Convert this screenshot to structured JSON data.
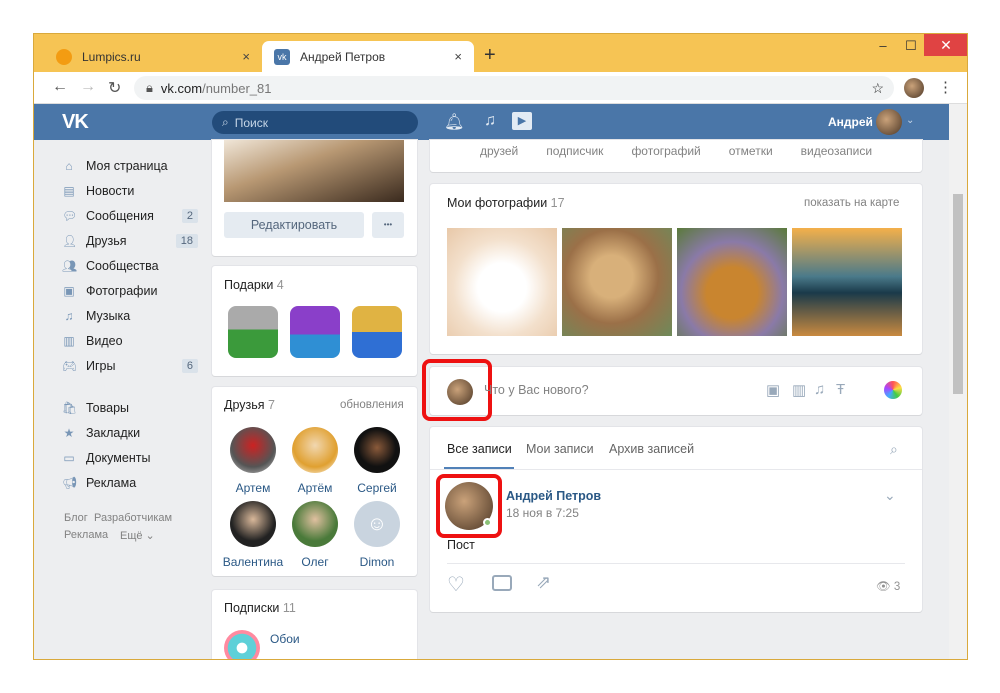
{
  "browser": {
    "tabs": [
      {
        "title": "Lumpics.ru",
        "close": "×"
      },
      {
        "title": "Андрей Петров",
        "close": "×"
      }
    ],
    "new_tab": "+",
    "window_controls": {
      "minimize": "–",
      "maximize": "☐",
      "close": "✕"
    },
    "url_host": "vk.com",
    "url_path": "/number_81"
  },
  "header": {
    "search_placeholder": "Поиск",
    "user_name": "Андрей"
  },
  "left_menu": [
    {
      "label": "Моя страница",
      "icon": "home-icon"
    },
    {
      "label": "Новости",
      "icon": "news-icon"
    },
    {
      "label": "Сообщения",
      "icon": "messages-icon",
      "count": "2"
    },
    {
      "label": "Друзья",
      "icon": "friends-icon",
      "count": "18"
    },
    {
      "label": "Сообщества",
      "icon": "communities-icon"
    },
    {
      "label": "Фотографии",
      "icon": "camera-icon"
    },
    {
      "label": "Музыка",
      "icon": "music-icon"
    },
    {
      "label": "Видео",
      "icon": "video-icon"
    },
    {
      "label": "Игры",
      "icon": "games-icon",
      "count": "6"
    },
    {
      "label": "Товары",
      "icon": "bag-icon"
    },
    {
      "label": "Закладки",
      "icon": "star-icon"
    },
    {
      "label": "Документы",
      "icon": "document-icon"
    },
    {
      "label": "Реклама",
      "icon": "ads-icon"
    }
  ],
  "footer_links": [
    "Блог",
    "Разработчикам",
    "Реклама",
    "Ещё ⌄"
  ],
  "profile": {
    "edit_button": "Редактировать",
    "more_button": "•••",
    "gifts_title": "Подарки",
    "gifts_count": "4",
    "friends_title": "Друзья",
    "friends_count": "7",
    "friends_updates": "обновления",
    "friends": [
      "Артем",
      "Артём",
      "Сергей",
      "Валентина",
      "Олег",
      "Dimon"
    ],
    "subs_title": "Подписки",
    "subs_count": "11",
    "sub_name": "Обои"
  },
  "counters": [
    "друзей",
    "подписчик",
    "фотографий",
    "отметки",
    "видеозаписи"
  ],
  "photos": {
    "title": "Мои фотографии",
    "count": "17",
    "map_link": "показать на карте"
  },
  "composer": {
    "placeholder": "Что у Вас нового?"
  },
  "wall": {
    "tabs": [
      "Все записи",
      "Мои записи",
      "Архив записей"
    ]
  },
  "post": {
    "author": "Андрей Петров",
    "date": "18 ноя в 7:25",
    "text": "Пост",
    "views": "3"
  },
  "colors": {
    "vk_blue": "#4a76a8",
    "tab_bar": "#f6c454",
    "highlight": "#e11111"
  }
}
